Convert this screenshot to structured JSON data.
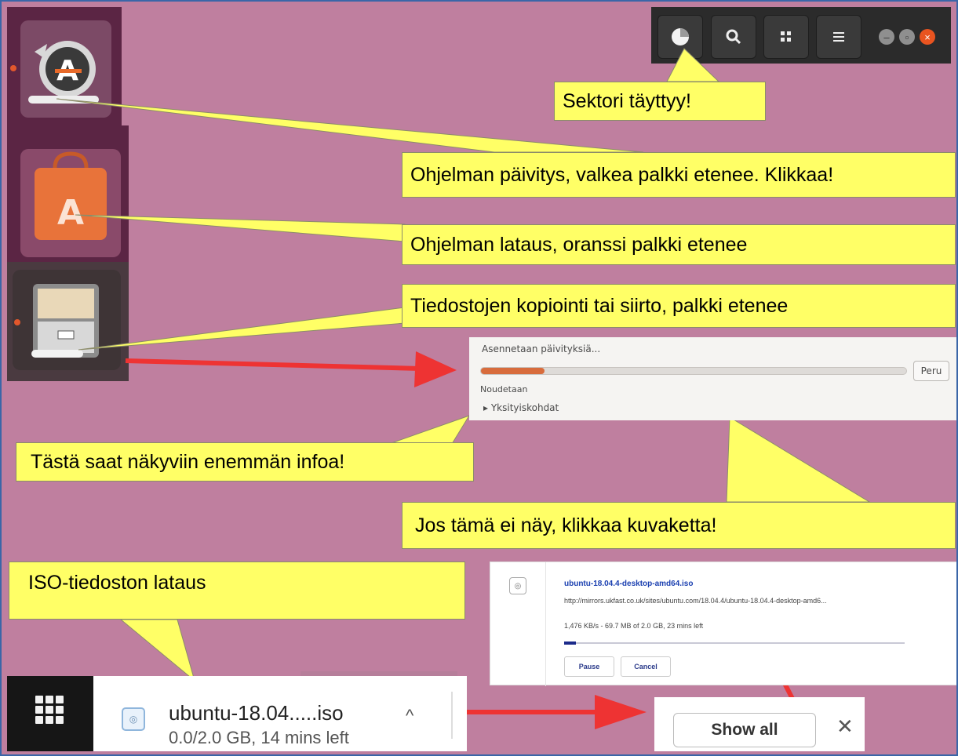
{
  "colors": {
    "background": "#bf7f9f",
    "callout": "#ffff66",
    "arrow": "#ee3333"
  },
  "launcher": {
    "items": [
      {
        "name": "software-updater",
        "icon": "software-updater-icon"
      },
      {
        "name": "ubuntu-software",
        "icon": "ubuntu-software-icon"
      },
      {
        "name": "files",
        "icon": "file-cabinet-icon"
      }
    ]
  },
  "topbar": {
    "icons": [
      "progress-pie-icon",
      "search-icon",
      "grid-icon",
      "menu-icon"
    ],
    "window_controls": [
      "minimize",
      "maximize",
      "close"
    ]
  },
  "callouts": {
    "sector": "Sektori täyttyy!",
    "updater": "Ohjelman päivitys, valkea palkki etenee. Klikkaa!",
    "software": "Ohjelman lataus, oranssi palkki etenee",
    "files": "Tiedostojen kopiointi tai siirto, palkki etenee",
    "details": "Tästä saat näkyviin enemmän infoa!",
    "click_icon": "Jos tämä ei näy, klikkaa kuvaketta!",
    "iso": "ISO-tiedoston lataus"
  },
  "update_dialog": {
    "status": "Asennetaan päivityksiä...",
    "progress": 0.15,
    "cancel_label": "Peru",
    "substatus": "Noudetaan",
    "details_toggle": "▸ Yksityiskohdat"
  },
  "download_card": {
    "filename": "ubuntu-18.04.4-desktop-amd64.iso",
    "url": "http://mirrors.ukfast.co.uk/sites/ubuntu.com/18.04.4/ubuntu-18.04.4-desktop-amd6...",
    "status": "1,476 KB/s - 69.7 MB of 2.0 GB, 23 mins left",
    "progress": 0.035,
    "pause_label": "Pause",
    "cancel_label": "Cancel"
  },
  "download_shelf": {
    "filename": "ubuntu-18.04.....iso",
    "status": "0.0/2.0 GB, 14 mins left",
    "show_all_label": "Show all",
    "close_label": "✕",
    "chevron": "^"
  }
}
